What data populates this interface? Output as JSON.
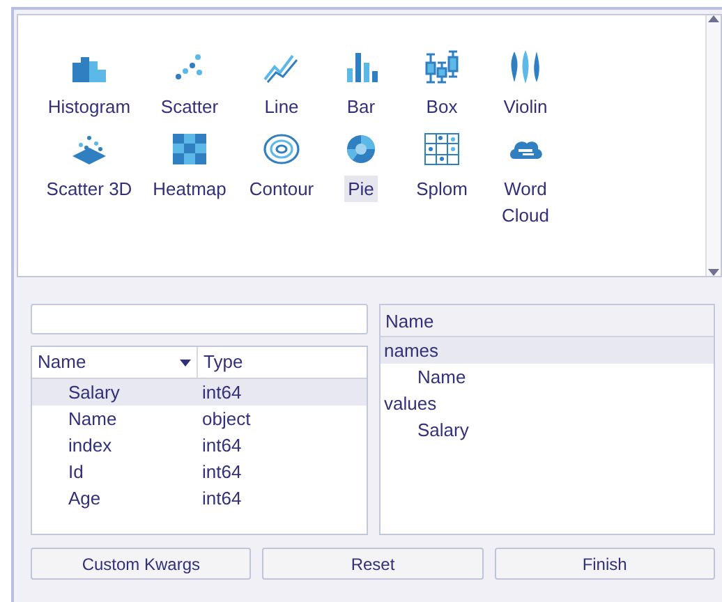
{
  "chart_types": [
    {
      "kind": "histogram",
      "label": "Histogram",
      "selected": false
    },
    {
      "kind": "scatter",
      "label": "Scatter",
      "selected": false
    },
    {
      "kind": "line",
      "label": "Line",
      "selected": false
    },
    {
      "kind": "bar",
      "label": "Bar",
      "selected": false
    },
    {
      "kind": "box",
      "label": "Box",
      "selected": false
    },
    {
      "kind": "violin",
      "label": "Violin",
      "selected": false
    },
    {
      "kind": "scatter3d",
      "label": "Scatter 3D",
      "selected": false
    },
    {
      "kind": "heatmap",
      "label": "Heatmap",
      "selected": false
    },
    {
      "kind": "contour",
      "label": "Contour",
      "selected": false
    },
    {
      "kind": "pie",
      "label": "Pie",
      "selected": true
    },
    {
      "kind": "splom",
      "label": "Splom",
      "selected": false
    },
    {
      "kind": "wordcloud",
      "label": "Word Cloud",
      "selected": false
    }
  ],
  "columns_table": {
    "columns": [
      {
        "label": "Name",
        "sorted": true
      },
      {
        "label": "Type",
        "sorted": false
      }
    ],
    "rows": [
      {
        "name": "Salary",
        "type": "int64",
        "selected": true
      },
      {
        "name": "Name",
        "type": "object",
        "selected": false
      },
      {
        "name": "index",
        "type": "int64",
        "selected": false
      },
      {
        "name": "Id",
        "type": "int64",
        "selected": false
      },
      {
        "name": "Age",
        "type": "int64",
        "selected": false
      }
    ]
  },
  "args_tree": {
    "header": "Name",
    "items": [
      {
        "label": "names",
        "selected": true,
        "children": [
          {
            "label": "Name",
            "selected": false
          }
        ]
      },
      {
        "label": "values",
        "selected": false,
        "children": [
          {
            "label": "Salary",
            "selected": false
          }
        ]
      }
    ]
  },
  "buttons": [
    "Custom Kwargs",
    "Reset",
    "Finish"
  ]
}
